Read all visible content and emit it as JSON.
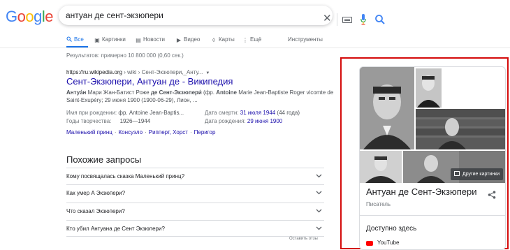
{
  "logo": {
    "text": "Google",
    "letters": [
      "G",
      "o",
      "o",
      "g",
      "l",
      "e"
    ],
    "colors": [
      "#4285F4",
      "#EA4335",
      "#FBBC05",
      "#4285F4",
      "#34A853",
      "#EA4335"
    ]
  },
  "search": {
    "query": "антуан де сент-экзюпери",
    "icons": [
      "close-icon",
      "keyboard-icon",
      "mic-icon",
      "search-icon"
    ]
  },
  "tabs": [
    {
      "label": "Все",
      "icon": "search-icon",
      "active": true
    },
    {
      "label": "Картинки",
      "icon": "image-icon"
    },
    {
      "label": "Новости",
      "icon": "news-icon"
    },
    {
      "label": "Видео",
      "icon": "video-icon"
    },
    {
      "label": "Карты",
      "icon": "map-pin-icon"
    },
    {
      "label": "Ещё",
      "icon": "more-icon"
    }
  ],
  "tools_label": "Инструменты",
  "stats": "Результатов: примерно 10 800 000 (0,60 сек.)",
  "result": {
    "url_host": "https://ru.wikipedia.org",
    "url_path": " › wiki › Сент-Экзюпери,_Анту...",
    "title": "Сент-Экзюпери, Антуан де - Википедия",
    "snippet_bold": "Антуа́н",
    "snippet_1": " Мари Жан-Батист Роже ",
    "snippet_bold2": "де Сент-Экзюпери́",
    "snippet_2": " (фр. ",
    "snippet_bold3": "Antoine",
    "snippet_3": " Marie Jean-Baptiste Roger vicomte de Saint-Exupéry; 29 июня 1900 (1900-06-29), Лион, ...",
    "facts": {
      "birth_name_label": "Имя при рождении:",
      "birth_name_value": "фр. Antoine Jean-Baptis...",
      "years_label": "Годы творчества:",
      "years_value": "1926—1944",
      "death_label": "Дата смерти:",
      "death_link": "31 июля 1944",
      "death_age": " (44 года)",
      "birth_label": "Дата рождения:",
      "birth_link": "29 июня 1900"
    },
    "sublinks": [
      "Маленький принц",
      "Консуэло",
      "Рипперт, Хорст",
      "Перигор"
    ]
  },
  "related": {
    "title": "Похожие запросы",
    "questions": [
      "Кому посвящалась сказка Маленький принц?",
      "Как умер А Экзюпери?",
      "Что сказал Экзюпери?",
      "Кто убил Антуана де Сент Экзюпери?"
    ],
    "feedback": "Оставить отзы"
  },
  "knowledge_panel": {
    "more_images": "Другие картинки",
    "name": "Антуан де Сент-Экзюпери",
    "description": "Писатель",
    "available_title": "Доступно здесь",
    "youtube": "YouTube",
    "highlight_color": "#d40b0b"
  }
}
